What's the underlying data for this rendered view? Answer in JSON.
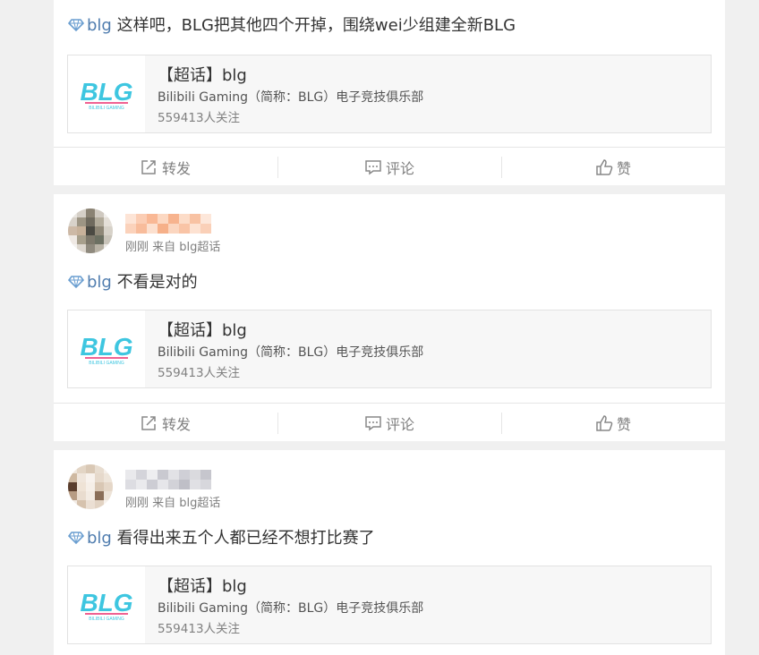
{
  "colors": {
    "page_bg": "#f0f0f0",
    "card_bg": "#ffffff",
    "tag": "#507daf",
    "logo_cyan": "#3ec6e0",
    "logo_pink": "#f06292",
    "muted": "#808080"
  },
  "posts": [
    {
      "tag": "blg",
      "text": " 这样吧，BLG把其他四个开掉，围绕wei少组建全新BLG",
      "topic": {
        "title": "【超话】blg",
        "description": "Bilibili Gaming（简称：BLG）电子竞技俱乐部",
        "followers": "559413人关注",
        "logo_text": "BLG",
        "logo_sub": "BILIBILI GAMING"
      },
      "actions": {
        "repost": "转发",
        "comment": "评论",
        "like": "赞"
      }
    },
    {
      "meta": "刚刚 来自 blg超话",
      "tag": "blg",
      "text": " 不看是对的",
      "topic": {
        "title": "【超话】blg",
        "description": "Bilibili Gaming（简称：BLG）电子竞技俱乐部",
        "followers": "559413人关注",
        "logo_text": "BLG",
        "logo_sub": "BILIBILI GAMING"
      },
      "actions": {
        "repost": "转发",
        "comment": "评论",
        "like": "赞"
      }
    },
    {
      "meta": "刚刚 来自 blg超话",
      "tag": "blg",
      "text": " 看得出来五个人都已经不想打比赛了",
      "topic": {
        "title": "【超话】blg",
        "description": "Bilibili Gaming（简称：BLG）电子竞技俱乐部",
        "followers": "559413人关注",
        "logo_text": "BLG",
        "logo_sub": "BILIBILI GAMING"
      }
    }
  ],
  "icons": {
    "tag": "diamond-icon",
    "repost": "repost-icon",
    "comment": "comment-icon",
    "like": "thumbs-up-icon"
  }
}
